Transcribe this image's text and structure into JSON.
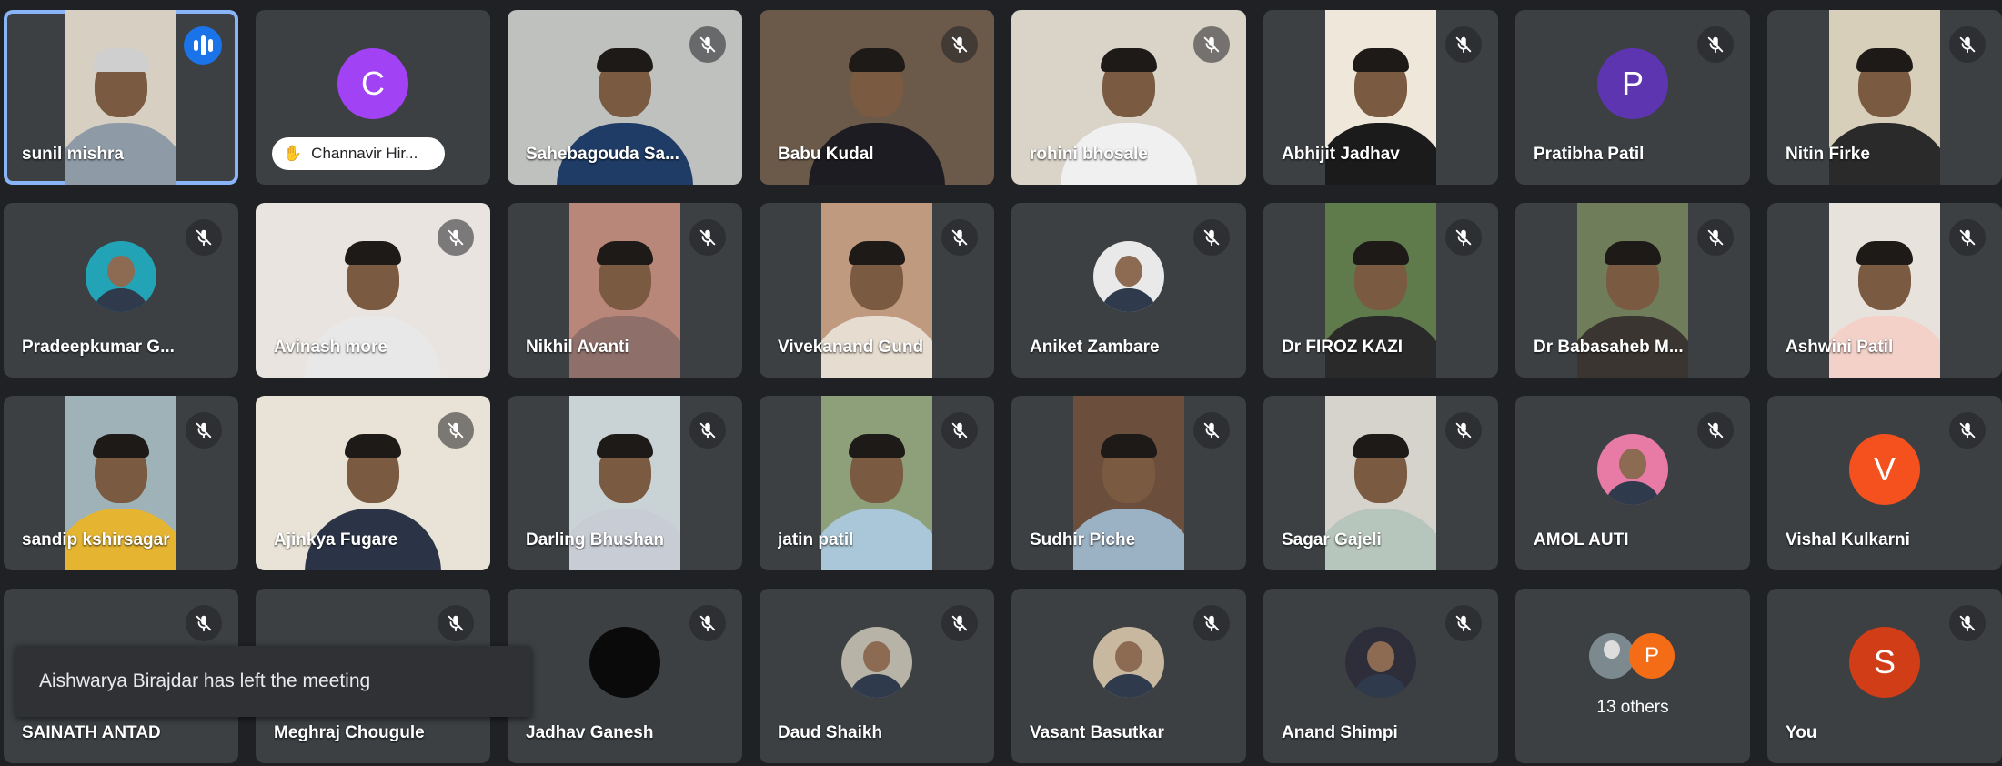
{
  "colors": {
    "tile": "#3c4043",
    "background": "#202124",
    "active_border": "#8ab4f8",
    "speaking": "#1a73e8"
  },
  "participants": [
    {
      "name": "sunil mishra",
      "type": "video",
      "active": true,
      "speaking": true,
      "bg": "#d6cfc2",
      "shirt": "#8e9aa6",
      "hair": "#cfcfcf"
    },
    {
      "name": "Channavir Hir...",
      "type": "avatar",
      "letter": "C",
      "avatar_color": "#a142f4",
      "pill": true
    },
    {
      "name": "Sahebagouda Sa...",
      "type": "video",
      "wide": true,
      "bg": "#bfc1bf",
      "shirt": "#1f3c66"
    },
    {
      "name": "Babu Kudal",
      "type": "video",
      "wide": true,
      "bg": "#6b5a4a",
      "shirt": "#1c1c22"
    },
    {
      "name": "rohini bhosale",
      "type": "video",
      "wide": true,
      "bg": "#d9d3c8",
      "shirt": "#f0f0f0"
    },
    {
      "name": "Abhijit Jadhav",
      "type": "video",
      "bg": "#efe7da",
      "shirt": "#1b1b1b"
    },
    {
      "name": "Pratibha Patil",
      "type": "avatar",
      "letter": "P",
      "avatar_color": "#5e35b1"
    },
    {
      "name": "Nitin Firke",
      "type": "video",
      "bg": "#d7cfb9",
      "shirt": "#2a2a2a"
    },
    {
      "name": "Pradeepkumar G...",
      "type": "photo",
      "photo_bg": "#22a3b6"
    },
    {
      "name": "Avinash more",
      "type": "video",
      "wide": true,
      "bg": "#e9e4df",
      "shirt": "#e8e8e8"
    },
    {
      "name": "Nikhil Avanti",
      "type": "video",
      "bg": "#b9867a",
      "shirt": "#8f6f6a"
    },
    {
      "name": "Vivekanand Gund",
      "type": "video",
      "bg": "#c09a7f",
      "shirt": "#e6dccf"
    },
    {
      "name": "Aniket Zambare",
      "type": "photo",
      "photo_bg": "#e9e9e9"
    },
    {
      "name": "Dr FIROZ KAZI",
      "type": "video",
      "bg": "#5f7a4b",
      "shirt": "#2a2a2a"
    },
    {
      "name": "Dr Babasaheb M...",
      "type": "video",
      "bg": "#6f7d5a",
      "shirt": "#3a3530"
    },
    {
      "name": "Ashwini Patil",
      "type": "video",
      "bg": "#e8e2dc",
      "shirt": "#f3d1c9"
    },
    {
      "name": "sandip kshirsagar",
      "type": "video",
      "bg": "#9fb2b8",
      "shirt": "#e5b532"
    },
    {
      "name": "Ajinkya Fugare",
      "type": "video",
      "wide": true,
      "bg": "#e8e3d6",
      "shirt": "#2b3447"
    },
    {
      "name": "Darling Bhushan",
      "type": "video",
      "bg": "#c9d3d6",
      "shirt": "#c8ccd4"
    },
    {
      "name": "jatin patil",
      "type": "video",
      "bg": "#8da07a",
      "shirt": "#a9c7d8"
    },
    {
      "name": "Sudhir Piche",
      "type": "video",
      "bg": "#6c4e3c",
      "shirt": "#9bb1c4"
    },
    {
      "name": "Sagar Gajeli",
      "type": "video",
      "bg": "#d6d2cc",
      "shirt": "#b7c6bc"
    },
    {
      "name": "AMOL AUTI",
      "type": "photo",
      "photo_bg": "#e87aa6"
    },
    {
      "name": "Vishal Kulkarni",
      "type": "avatar",
      "letter": "V",
      "avatar_color": "#f4511e"
    },
    {
      "name": "SAINATH ANTAD",
      "type": "blank"
    },
    {
      "name": "Meghraj Chougule",
      "type": "blank"
    },
    {
      "name": "Jadhav Ganesh",
      "type": "photo",
      "photo_bg": "#0a0a0a"
    },
    {
      "name": "Daud Shaikh",
      "type": "photo",
      "photo_bg": "#b7b3a6"
    },
    {
      "name": "Vasant Basutkar",
      "type": "photo",
      "photo_bg": "#c9b8a0"
    },
    {
      "name": "Anand Shimpi",
      "type": "photo",
      "photo_bg": "#2e2e3a"
    },
    {
      "name": "13 others",
      "type": "others",
      "others_letter": "P"
    },
    {
      "name": "You",
      "type": "avatar",
      "letter": "S",
      "avatar_color": "#d13d16"
    }
  ],
  "toast": {
    "text": "Aishwarya Birajdar has left the meeting"
  }
}
